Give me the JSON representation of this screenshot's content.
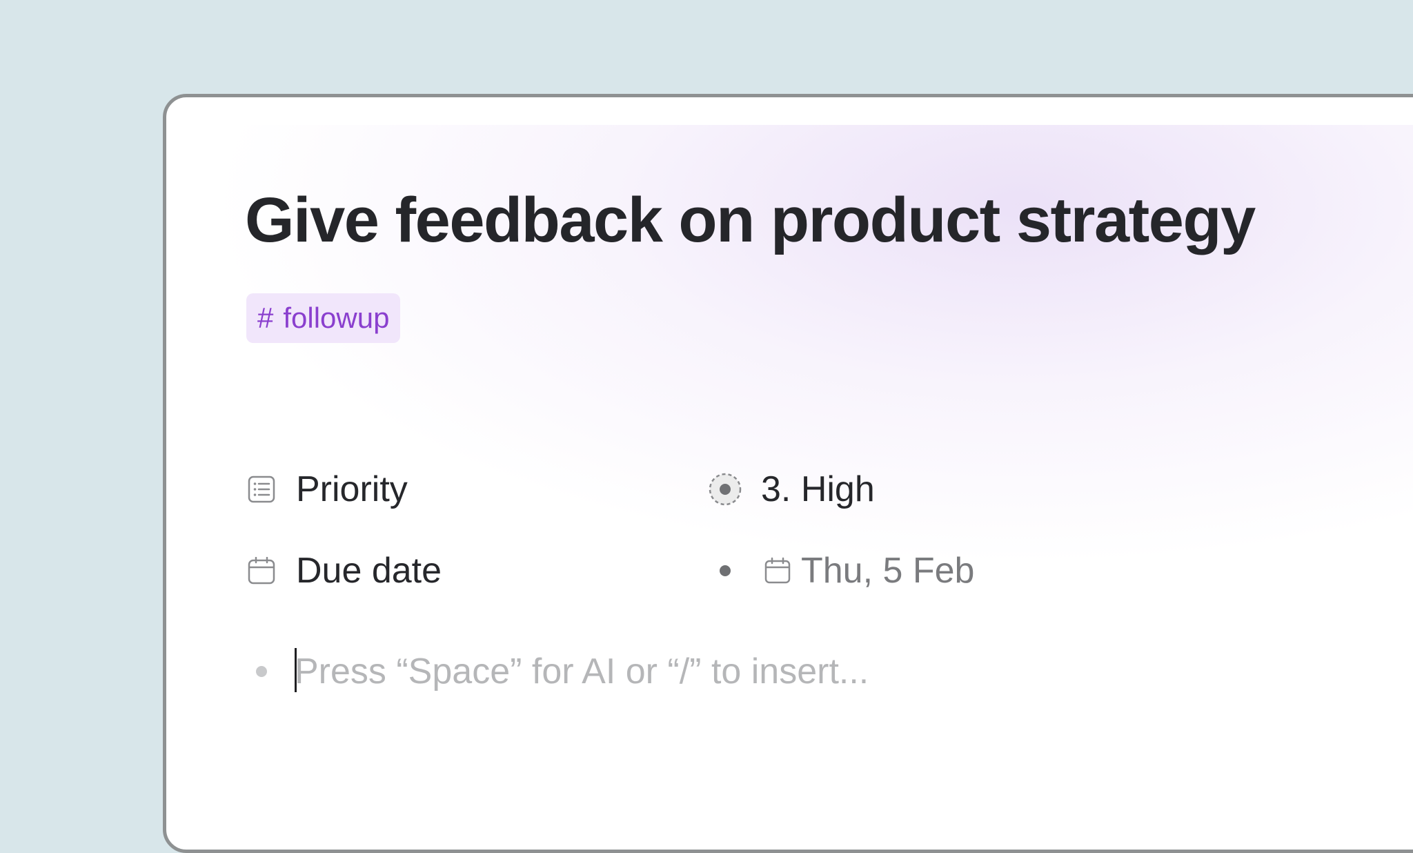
{
  "task": {
    "title": "Give feedback on product strategy",
    "tag": {
      "symbol": "#",
      "label": "followup"
    }
  },
  "properties": [
    {
      "label": "Priority",
      "icon": "list-icon",
      "value": "3. High",
      "value_icon": "status-circle-icon"
    },
    {
      "label": "Due date",
      "icon": "calendar-icon",
      "value": "Thu, 5 Feb",
      "value_icon": "calendar-icon"
    }
  ],
  "editor": {
    "placeholder": "Press “Space” for AI or “/” to insert..."
  },
  "colors": {
    "background": "#d8e6ea",
    "tag_bg": "#f1e6fb",
    "tag_text": "#8a3fce",
    "text": "#26272b",
    "muted": "#7a7b7e"
  }
}
